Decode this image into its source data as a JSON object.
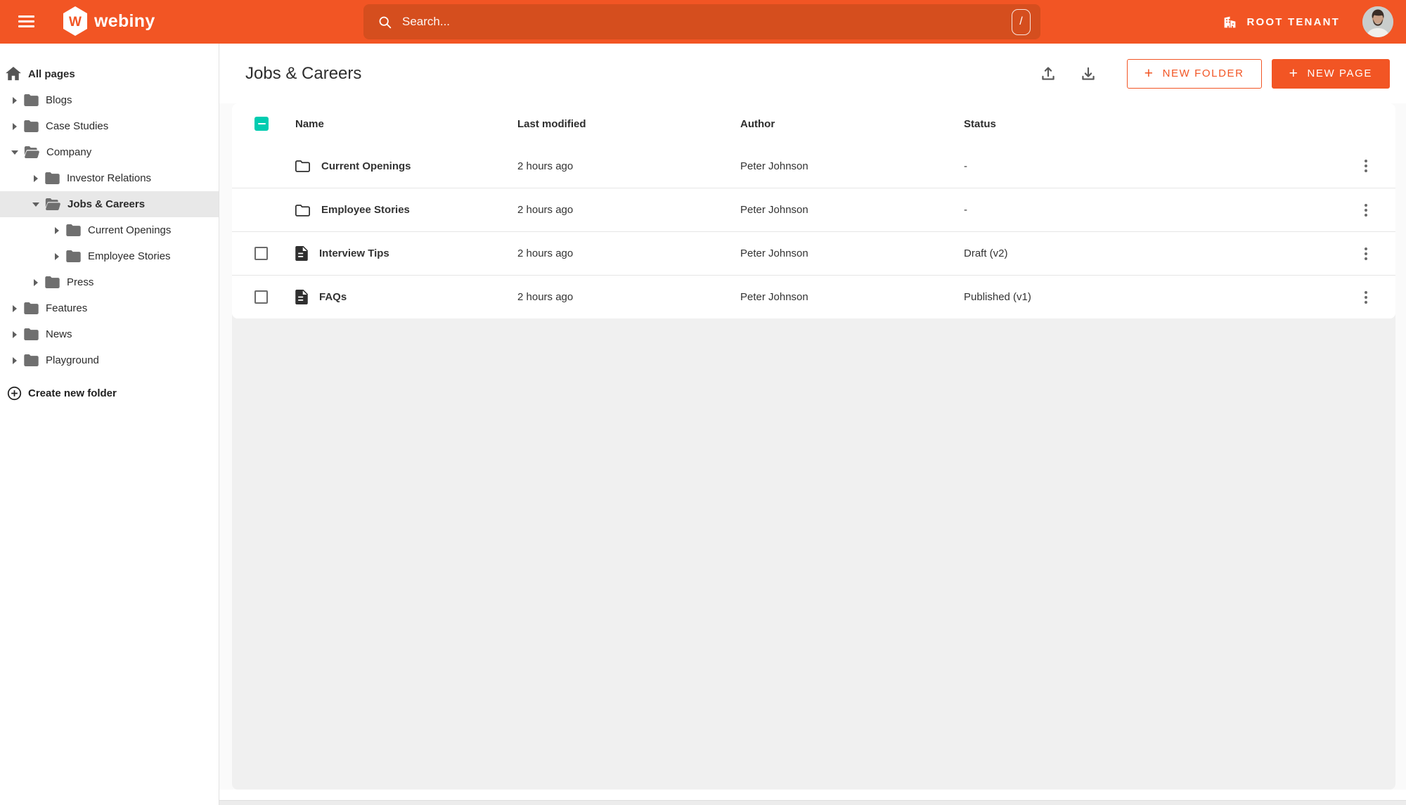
{
  "topbar": {
    "brand": "webiny",
    "brand_initial": "W",
    "search": {
      "placeholder": "Search...",
      "shortcut": "/"
    },
    "tenant": {
      "label": "ROOT TENANT"
    }
  },
  "sidebar": {
    "all_pages_label": "All pages",
    "create_folder_label": "Create new folder",
    "items": [
      {
        "label": "Blogs",
        "level": 0,
        "state": "collapsed",
        "selected": false
      },
      {
        "label": "Case Studies",
        "level": 0,
        "state": "collapsed",
        "selected": false
      },
      {
        "label": "Company",
        "level": 0,
        "state": "expanded",
        "selected": false
      },
      {
        "label": "Investor Relations",
        "level": 1,
        "state": "collapsed",
        "selected": false
      },
      {
        "label": "Jobs & Careers",
        "level": 1,
        "state": "expanded",
        "selected": true
      },
      {
        "label": "Current Openings",
        "level": 2,
        "state": "collapsed",
        "selected": false
      },
      {
        "label": "Employee Stories",
        "level": 2,
        "state": "collapsed",
        "selected": false
      },
      {
        "label": "Press",
        "level": 1,
        "state": "collapsed",
        "selected": false
      },
      {
        "label": "Features",
        "level": 0,
        "state": "collapsed",
        "selected": false
      },
      {
        "label": "News",
        "level": 0,
        "state": "collapsed",
        "selected": false
      },
      {
        "label": "Playground",
        "level": 0,
        "state": "collapsed",
        "selected": false
      }
    ]
  },
  "main": {
    "title": "Jobs & Careers",
    "actions": {
      "new_folder": "NEW FOLDER",
      "new_page": "NEW PAGE"
    }
  },
  "table": {
    "columns": {
      "name": "Name",
      "modified": "Last modified",
      "author": "Author",
      "status": "Status"
    },
    "header_checkbox_state": "indeterminate",
    "rows": [
      {
        "type": "folder",
        "name": "Current Openings",
        "modified": "2 hours ago",
        "author": "Peter Johnson",
        "status": "-",
        "checkbox": false
      },
      {
        "type": "folder",
        "name": "Employee Stories",
        "modified": "2 hours ago",
        "author": "Peter Johnson",
        "status": "-",
        "checkbox": false
      },
      {
        "type": "page",
        "name": "Interview Tips",
        "modified": "2 hours ago",
        "author": "Peter Johnson",
        "status": "Draft (v2)",
        "checkbox": true
      },
      {
        "type": "page",
        "name": "FAQs",
        "modified": "2 hours ago",
        "author": "Peter Johnson",
        "status": "Published (v1)",
        "checkbox": true
      }
    ]
  },
  "colors": {
    "accent_orange": "#F25524",
    "search_bar_bg": "#D54E1E",
    "checkbox_teal": "#00CCB0"
  },
  "icons": [
    "menu-icon",
    "webiny-logo",
    "search-icon",
    "slash-shortcut-key",
    "building-icon",
    "user-avatar",
    "home-icon",
    "folder-icon",
    "plus-circle-icon",
    "upload-icon",
    "download-icon",
    "file-icon",
    "kebab-menu-icon",
    "caret-icon"
  ]
}
